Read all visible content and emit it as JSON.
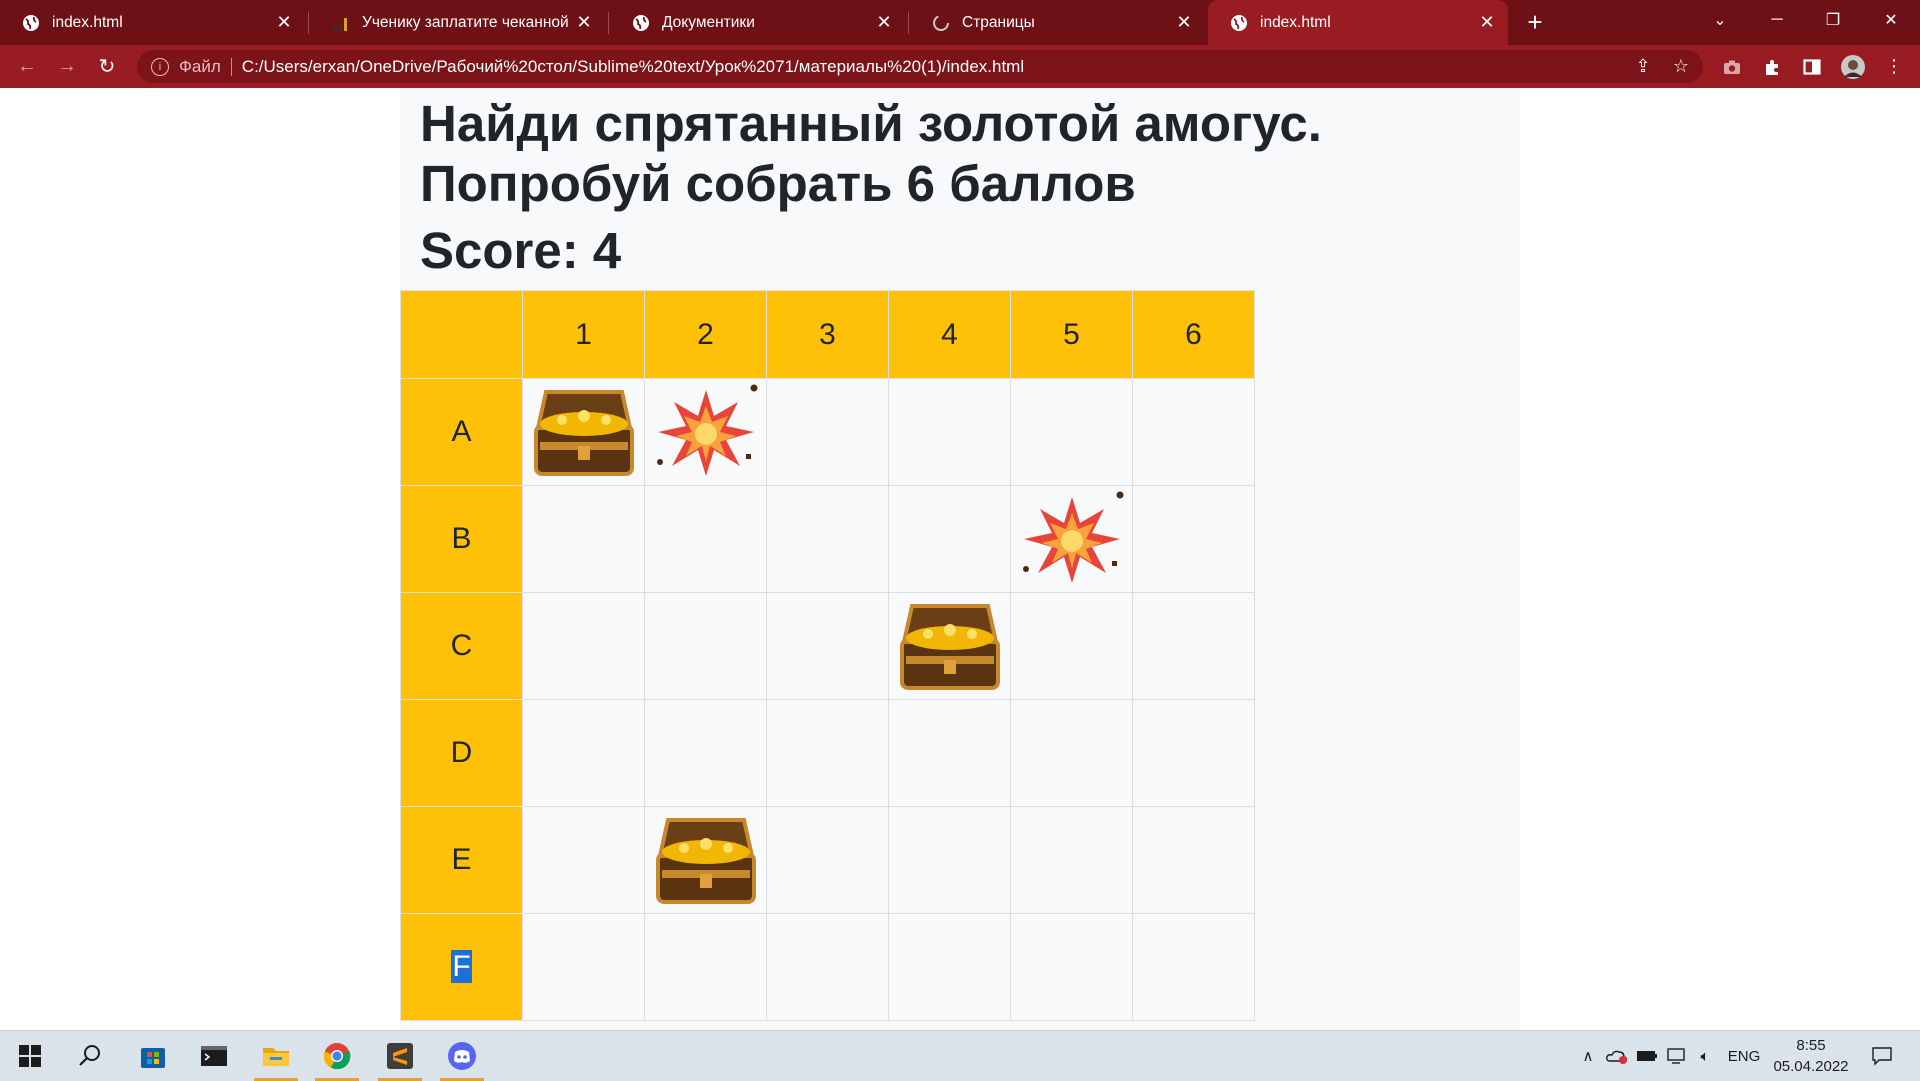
{
  "browser": {
    "tabs": [
      {
        "title": "index.html",
        "icon": "globe-icon",
        "active": false
      },
      {
        "title": "Ученику заплатите чеканной монетой",
        "icon": "chart-icon",
        "active": false
      },
      {
        "title": "Документики",
        "icon": "globe-icon",
        "active": false
      },
      {
        "title": "Страницы",
        "icon": "github-icon",
        "active": false
      },
      {
        "title": "index.html",
        "icon": "globe-icon",
        "active": true
      }
    ],
    "new_tab": "+",
    "address": {
      "scheme_label": "Файл",
      "url": "C:/Users/erxan/OneDrive/Рабочий%20стол/Sublime%20text/Урок%2071/материалы%20(1)/index.html"
    },
    "accent_color": "#9a1c23"
  },
  "page": {
    "heading_line1": "Найди спрятанный золотой амогус.",
    "heading_line2": "Попробуй собрать 6 баллов",
    "score_label": "Score:",
    "score_value": "4",
    "grid": {
      "header_color": "#ffc107",
      "corner": "",
      "columns": [
        "1",
        "2",
        "3",
        "4",
        "5",
        "6"
      ],
      "rows": [
        {
          "label": "A",
          "cells": [
            "chest",
            "explosion",
            "",
            "",
            "",
            ""
          ]
        },
        {
          "label": "B",
          "cells": [
            "",
            "",
            "",
            "",
            "explosion",
            ""
          ]
        },
        {
          "label": "C",
          "cells": [
            "",
            "",
            "",
            "chest",
            "",
            ""
          ]
        },
        {
          "label": "D",
          "cells": [
            "",
            "",
            "",
            "",
            "",
            ""
          ]
        },
        {
          "label": "E",
          "cells": [
            "",
            "chest",
            "",
            "",
            "",
            ""
          ]
        },
        {
          "label": "F",
          "cells": [
            "",
            "",
            "",
            "",
            "",
            ""
          ],
          "label_selected": true
        }
      ]
    }
  },
  "taskbar": {
    "apps": [
      "windows-start-icon",
      "search-icon",
      "microsoft-store-icon",
      "terminal-icon",
      "file-explorer-icon",
      "chrome-icon",
      "sublime-text-icon",
      "discord-icon"
    ],
    "language": "ENG",
    "time": "8:55",
    "date": "05.04.2022"
  }
}
